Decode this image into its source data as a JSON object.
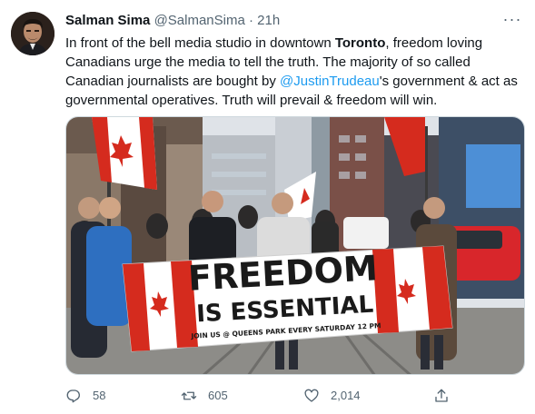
{
  "tweet": {
    "author_name": "Salman Sima",
    "author_handle": "@SalmanSima",
    "separator": "·",
    "time": "21h",
    "more_icon": "more-icon",
    "text_1": "In front of the bell media studio in downtown ",
    "text_bold": "Toronto",
    "text_2": ", freedom loving Canadians urge the media to tell the truth. The majority of so called Canadian journalists are bought by ",
    "text_mention": "@JustinTrudeau",
    "text_3": "'s government & act as governmental operatives. Truth will prevail & freedom will win."
  },
  "media": {
    "banner_line1": "FREEDOM",
    "banner_line2": "IS ESSENTIAL",
    "banner_line3": "JOIN US @ QUEENS PARK EVERY SATURDAY 12 PM",
    "banner_color": "#d52b1e"
  },
  "actions": {
    "reply_count": "58",
    "retweet_count": "605",
    "like_count": "2,014",
    "reply_icon": "reply-icon",
    "retweet_icon": "retweet-icon",
    "like_icon": "heart-icon",
    "share_icon": "share-icon"
  },
  "colors": {
    "link": "#1d9bf0",
    "muted": "#536471",
    "text": "#0f1419"
  }
}
